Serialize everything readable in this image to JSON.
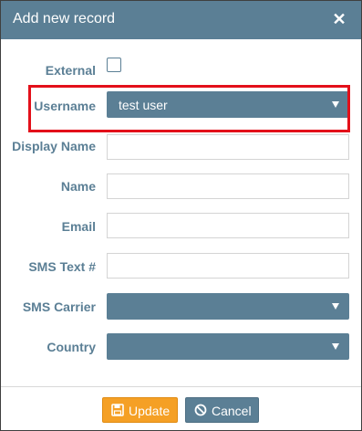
{
  "dialog": {
    "title": "Add new record",
    "close_symbol": "✕"
  },
  "form": {
    "external_label": "External",
    "external_checked": false,
    "username_label": "Username",
    "username_value": "test user",
    "display_name_label": "Display Name",
    "display_name_value": "",
    "name_label": "Name",
    "name_value": "",
    "email_label": "Email",
    "email_value": "",
    "sms_text_label": "SMS Text #",
    "sms_text_value": "",
    "sms_carrier_label": "SMS Carrier",
    "sms_carrier_value": "",
    "country_label": "Country",
    "country_value": ""
  },
  "footer": {
    "update_label": "Update",
    "cancel_label": "Cancel"
  },
  "colors": {
    "header": "#5b7f95",
    "label": "#5b7f95",
    "update_button": "#f5a025",
    "highlight": "#e3101a"
  },
  "icons": {
    "close": "close-icon",
    "save": "save-icon",
    "cancel": "cancel-icon",
    "dropdown": "chevron-down-icon"
  }
}
